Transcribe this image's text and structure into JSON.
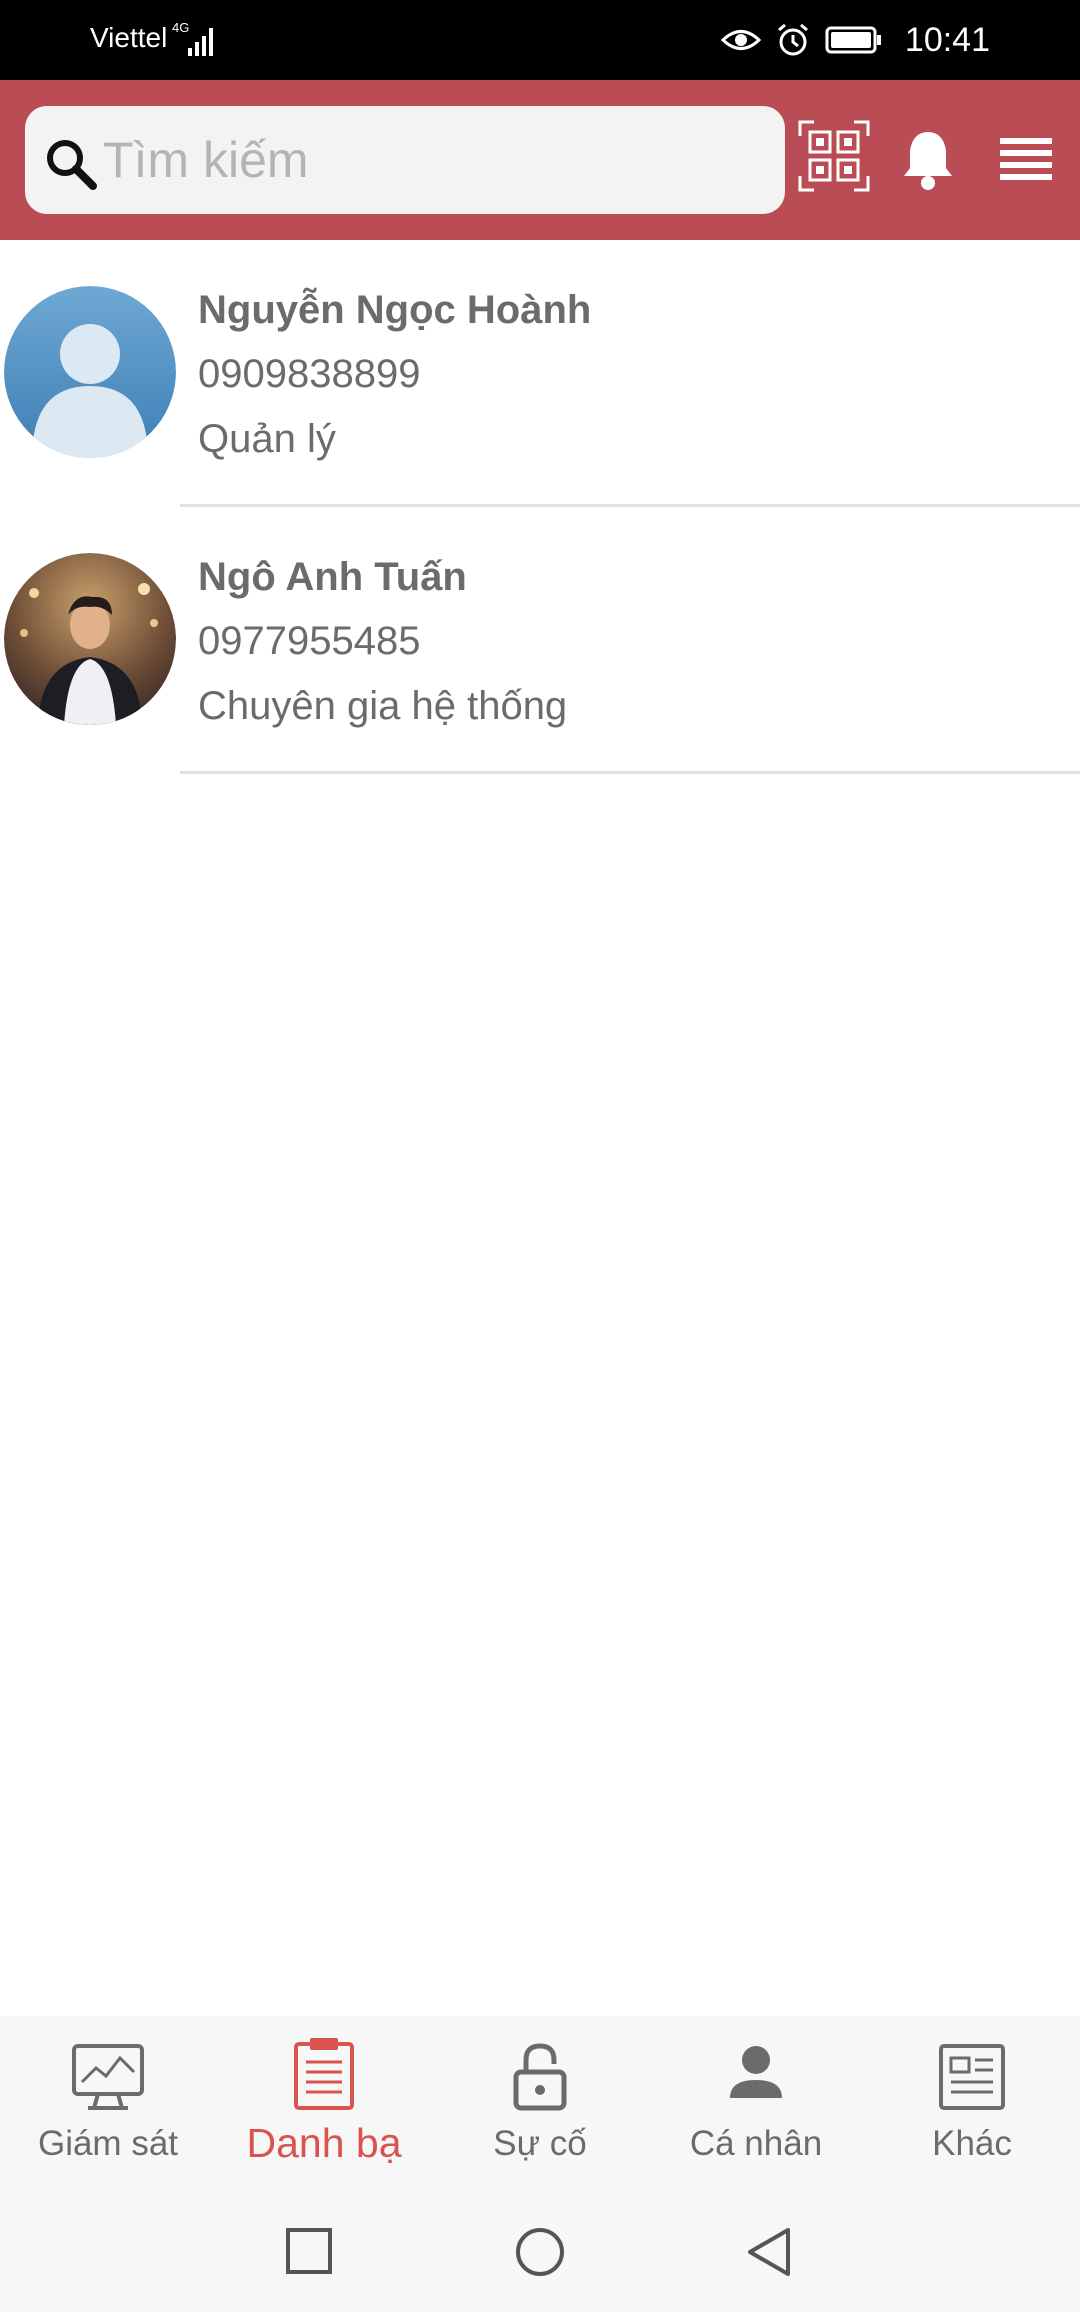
{
  "status_bar": {
    "carrier": "Viettel",
    "network": "4G",
    "time": "10:41"
  },
  "search": {
    "placeholder": "Tìm kiếm"
  },
  "header_icons": [
    "qr-code-icon",
    "bell-icon",
    "menu-icon"
  ],
  "contacts": [
    {
      "name": "Nguyễn Ngọc Hoành",
      "phone": "0909838899",
      "role": "Quản lý",
      "avatar": "default-avatar"
    },
    {
      "name": "Ngô Anh Tuấn",
      "phone": "0977955485",
      "role": "Chuyên gia hệ thống",
      "avatar": "photo-avatar"
    }
  ],
  "bottom_nav": {
    "items": [
      {
        "label": "Giám sát",
        "icon": "monitor-chart-icon",
        "active": false
      },
      {
        "label": "Danh bạ",
        "icon": "clipboard-icon",
        "active": true
      },
      {
        "label": "Sự cố",
        "icon": "lock-icon",
        "active": false
      },
      {
        "label": "Cá nhân",
        "icon": "person-icon",
        "active": false
      },
      {
        "label": "Khác",
        "icon": "newspaper-icon",
        "active": false
      }
    ]
  },
  "colors": {
    "header": "#b94c55",
    "active": "#d9534f",
    "text": "#6b6b6b"
  }
}
